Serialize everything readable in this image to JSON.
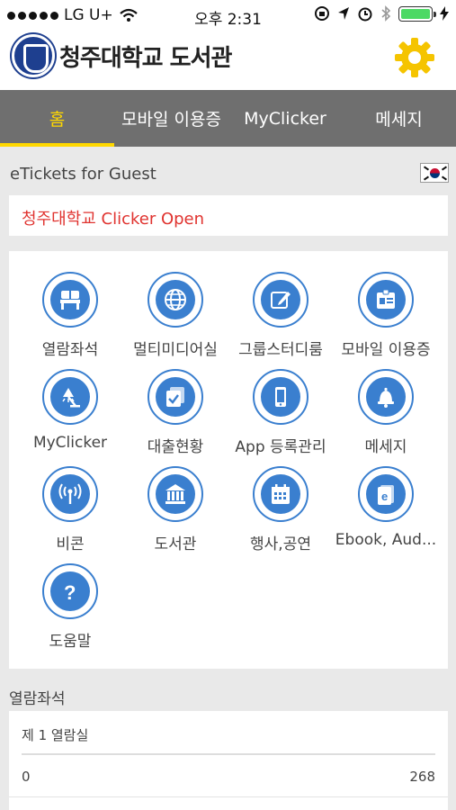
{
  "status_bar": {
    "carrier": "LG U+",
    "time": "오후 2:31"
  },
  "header": {
    "title": "청주대학교 도서관"
  },
  "tabs": [
    {
      "label": "홈",
      "active": true
    },
    {
      "label": "모바일 이용증",
      "active": false
    },
    {
      "label": "MyClicker",
      "active": false
    },
    {
      "label": "메세지",
      "active": false
    }
  ],
  "etickets": {
    "label": "eTickets for Guest"
  },
  "banner": {
    "text": "청주대학교 Clicker Open"
  },
  "menu": [
    {
      "label": "열람좌석",
      "icon": "seat-icon"
    },
    {
      "label": "멀티미디어실",
      "icon": "globe-icon"
    },
    {
      "label": "그룹스터디룸",
      "icon": "edit-icon"
    },
    {
      "label": "모바일 이용증",
      "icon": "id-card-icon"
    },
    {
      "label": "MyClicker",
      "icon": "lamp-icon"
    },
    {
      "label": "대출현황",
      "icon": "checklist-icon"
    },
    {
      "label": "App 등록관리",
      "icon": "phone-icon"
    },
    {
      "label": "메세지",
      "icon": "bell-icon"
    },
    {
      "label": "비콘",
      "icon": "beacon-icon"
    },
    {
      "label": "도서관",
      "icon": "library-icon"
    },
    {
      "label": "행사,공연",
      "icon": "calendar-icon"
    },
    {
      "label": "Ebook, Aud...",
      "icon": "ebook-icon"
    },
    {
      "label": "도움말",
      "icon": "help-icon"
    }
  ],
  "seats": {
    "title": "열람좌석",
    "rooms": [
      {
        "name": "제 1 열람실",
        "min": "0",
        "max": "268"
      }
    ]
  },
  "colors": {
    "accent": "#ffd800",
    "tab_bg": "#6f6f6f",
    "icon_blue": "#3a7fcf",
    "banner_red": "#e0332f"
  }
}
